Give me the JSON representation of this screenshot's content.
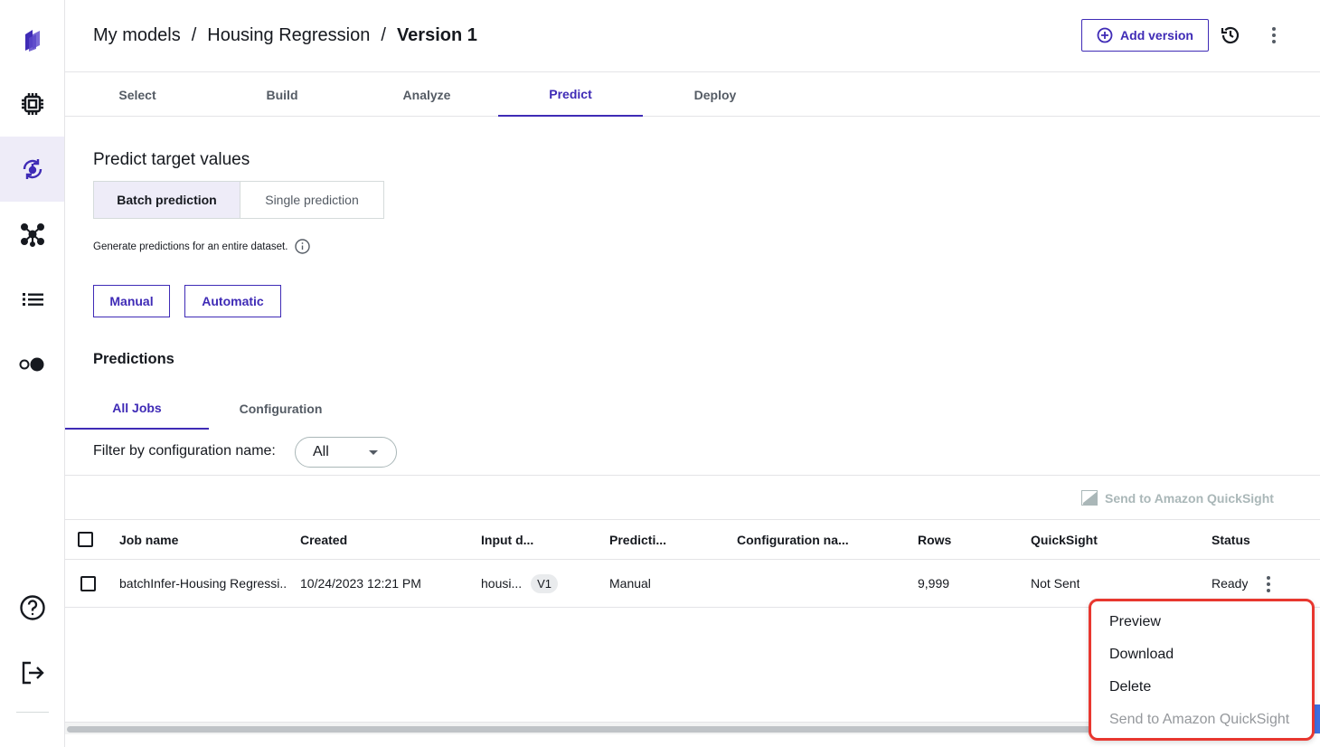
{
  "breadcrumb": {
    "items": [
      "My models",
      "Housing Regression"
    ],
    "separator": "/",
    "current": "Version 1"
  },
  "header": {
    "add_version_label": "Add version"
  },
  "steps": [
    "Select",
    "Build",
    "Analyze",
    "Predict",
    "Deploy"
  ],
  "predict": {
    "title": "Predict target values",
    "segments": {
      "batch": "Batch prediction",
      "single": "Single prediction"
    },
    "hint": "Generate predictions for an entire dataset.",
    "manual_label": "Manual",
    "automatic_label": "Automatic"
  },
  "predictions": {
    "title": "Predictions",
    "tabs": [
      "All Jobs",
      "Configuration"
    ],
    "filter_label": "Filter by configuration name:",
    "filter_value": "All",
    "send_quicksight_label": "Send to Amazon QuickSight"
  },
  "table": {
    "headers": [
      "Job name",
      "Created",
      "Input d...",
      "Predicti...",
      "Configuration na...",
      "Rows",
      "QuickSight",
      "Status"
    ],
    "rows": [
      {
        "job_name": "batchInfer-Housing Regressi..",
        "created": "10/24/2023 12:21 PM",
        "input": "housi...",
        "input_version": "V1",
        "prediction": "Manual",
        "configuration": "",
        "rows": "9,999",
        "quicksight": "Not Sent",
        "status": "Ready"
      }
    ]
  },
  "menu": {
    "items": [
      "Preview",
      "Download",
      "Delete",
      "Send to Amazon QuickSight"
    ]
  },
  "colors": {
    "accent": "#3f2bb6",
    "highlight_border": "#e8372f",
    "active_rail_bg": "#eeecf8"
  },
  "icons": {
    "rail": [
      "canvas-logo-icon",
      "chip-icon",
      "ml-ops-icon",
      "network-icon",
      "list-icon",
      "toggle-icon",
      "help-icon",
      "sign-out-icon"
    ],
    "header": [
      "plus-circle-icon",
      "history-icon",
      "more-vertical-icon"
    ]
  }
}
